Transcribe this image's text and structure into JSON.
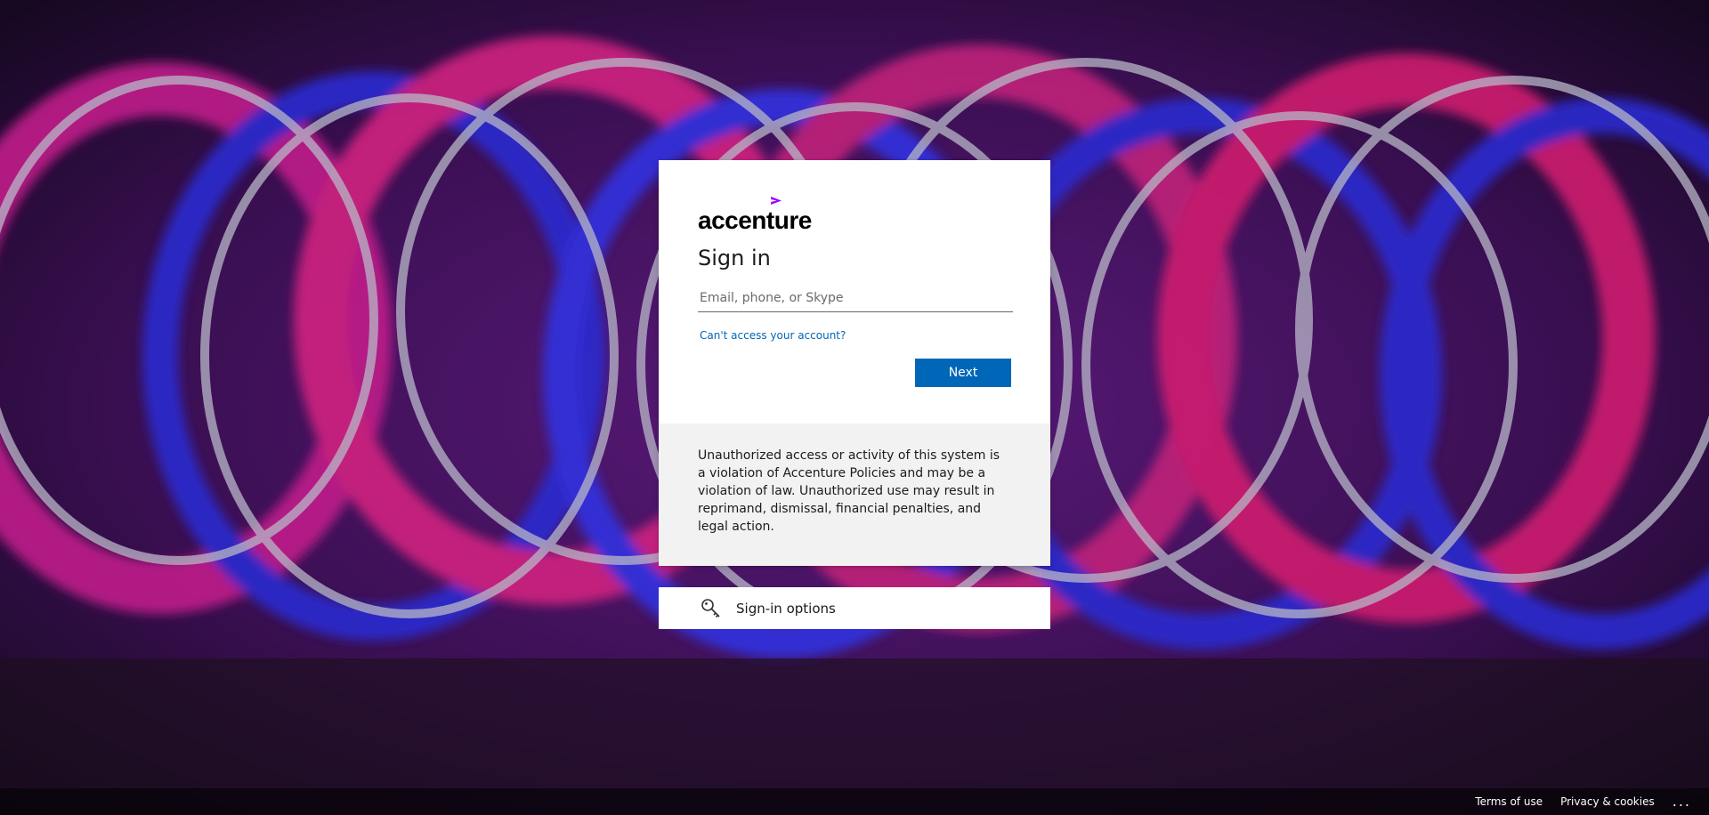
{
  "brand": {
    "name": "accenture",
    "accent_color": "#a100ff"
  },
  "signin": {
    "title": "Sign in",
    "email_placeholder": "Email, phone, or Skype",
    "cant_access": "Can't access your account?",
    "next_label": "Next",
    "button_color": "#0067b8"
  },
  "notice": {
    "text": "Unauthorized access or activity of this system is a violation of Accenture Policies and may be a violation of law. Unauthorized use may result in reprimand, dismissal, financial penalties, and legal action."
  },
  "options": {
    "label": "Sign-in options",
    "icon": "key-icon"
  },
  "footer": {
    "terms": "Terms of use",
    "privacy": "Privacy & cookies",
    "more": "..."
  },
  "background": {
    "description_icon": "light-painting-background"
  }
}
